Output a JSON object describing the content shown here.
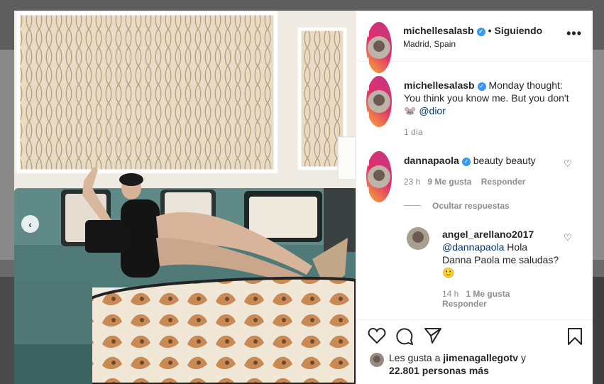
{
  "post": {
    "author": "michellesalasb",
    "follow_state": "Siguiendo",
    "location": "Madrid, Spain",
    "caption_line1": "Monday thought:",
    "caption_line2": "You think you know me. But you don't",
    "caption_emoji": "🐭",
    "caption_mention": "@dior",
    "age": "1 día"
  },
  "comments": [
    {
      "user": "dannapaola",
      "text": "beauty beauty",
      "time": "23 h",
      "likes": "9 Me gusta",
      "reply": "Responder"
    }
  ],
  "hide_replies": "Ocultar respuestas",
  "reply": {
    "user": "angel_arellano2017",
    "mention": "@dannapaola",
    "text_1": "Hola",
    "text_2": "Danna Paola me saludas?",
    "emoji": "🙂",
    "time": "14 h",
    "likes": "1 Me gusta",
    "reply": "Responder"
  },
  "likes": {
    "prefix": "Les gusta a",
    "user": "jimenagallegotv",
    "connector": "y",
    "count": "22.801 personas más"
  },
  "icons": {
    "more": "more-options-icon",
    "like": "heart-icon",
    "comment": "comment-icon",
    "share": "share-icon",
    "save": "bookmark-icon",
    "prev": "chevron-left-icon",
    "verified": "verified-badge-icon"
  },
  "colors": {
    "accent_blue": "#3897f0",
    "mention": "#00376b",
    "muted": "#8e8e8e"
  }
}
